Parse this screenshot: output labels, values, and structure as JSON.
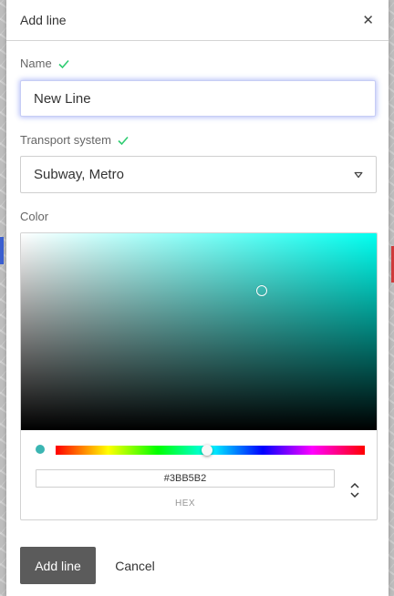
{
  "dialog": {
    "title": "Add line",
    "close_icon": "close-icon"
  },
  "name_field": {
    "label": "Name",
    "value": "New Line",
    "valid_icon": "check-icon",
    "valid_color": "#2ecc71"
  },
  "transport_field": {
    "label": "Transport system",
    "value": "Subway, Metro",
    "valid_icon": "check-icon",
    "dropdown_icon": "caret-down-icon"
  },
  "color_field": {
    "label": "Color",
    "hex_value": "#3BB5B2",
    "mode_label": "HEX",
    "swatch_color": "#3BB5B2",
    "hue_fraction": 0.49,
    "mode_toggle_icon": "chevron-up-down-icon"
  },
  "actions": {
    "submit_label": "Add line",
    "cancel_label": "Cancel"
  }
}
